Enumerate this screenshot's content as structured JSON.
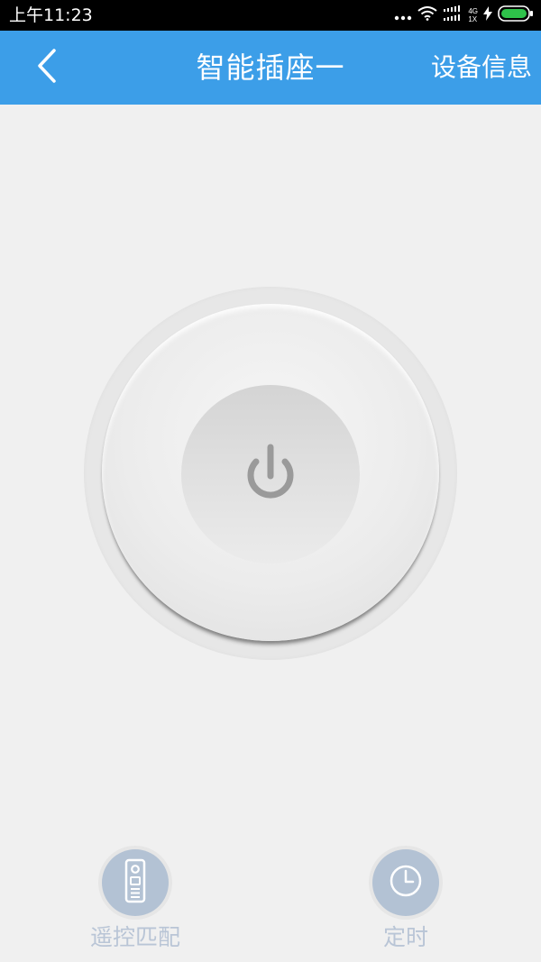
{
  "status_bar": {
    "time": "上午11:23",
    "net_top": "4G",
    "net_bottom": "1X"
  },
  "header": {
    "title": "智能插座一",
    "device_info_label": "设备信息"
  },
  "actions": {
    "remote_match_label": "遥控匹配",
    "timer_label": "定时"
  },
  "colors": {
    "header_bg": "#3c9ee8",
    "page_bg": "#f0f0f0",
    "action_icon_bg": "#b3c2d4",
    "action_label": "#b9c5d6",
    "power_icon": "#9a9a9a",
    "battery": "#2ec24a"
  },
  "icons": {
    "back": "chevron-left-icon",
    "power": "power-icon",
    "remote": "remote-control-icon",
    "timer": "clock-icon"
  }
}
